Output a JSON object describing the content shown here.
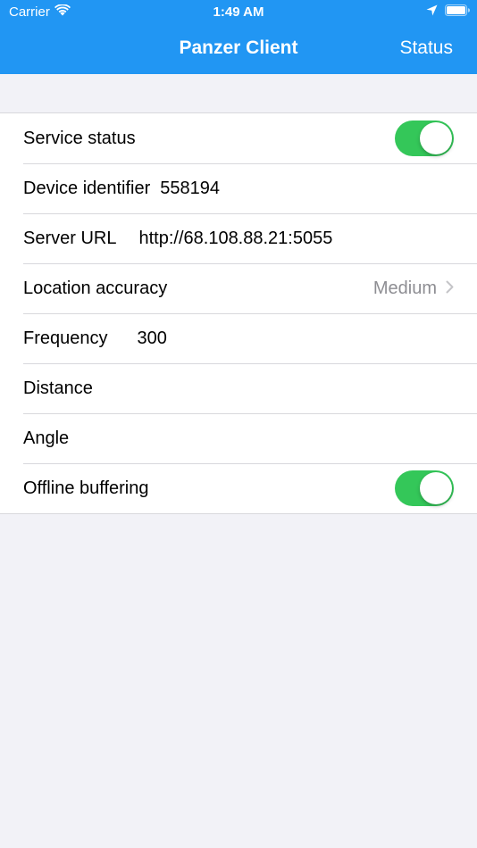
{
  "status_bar": {
    "carrier": "Carrier",
    "time": "1:49 AM"
  },
  "nav": {
    "title": "Panzer Client",
    "action_label": "Status"
  },
  "settings": {
    "service_status": {
      "label": "Service status",
      "on": true
    },
    "device_identifier": {
      "label": "Device identifier",
      "value": "558194"
    },
    "server_url": {
      "label": "Server URL",
      "value": "http://68.108.88.21:5055"
    },
    "location_accuracy": {
      "label": "Location accuracy",
      "value": "Medium"
    },
    "frequency": {
      "label": "Frequency",
      "value": "300"
    },
    "distance": {
      "label": "Distance",
      "value": ""
    },
    "angle": {
      "label": "Angle",
      "value": ""
    },
    "offline_buffering": {
      "label": "Offline buffering",
      "on": true
    }
  },
  "colors": {
    "nav_background": "#2196f3",
    "toggle_on": "#34c759",
    "page_background": "#f2f2f7",
    "secondary_text": "#8e8e93"
  },
  "icons": {
    "wifi": "wifi-icon",
    "location": "location-arrow-icon",
    "battery": "battery-icon",
    "chevron": "chevron-right-icon"
  }
}
